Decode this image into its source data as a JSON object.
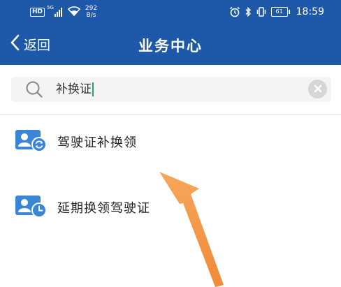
{
  "status_bar": {
    "hd_badge": "HD",
    "network_type": "5G",
    "speed_value": "292",
    "speed_unit": "B/s",
    "battery": "61",
    "time": "18:59"
  },
  "nav": {
    "back_label": "返回",
    "title": "业务中心"
  },
  "search": {
    "value": "补换证"
  },
  "results": [
    {
      "label": "驾驶证补换领",
      "icon": "license-refresh-icon"
    },
    {
      "label": "延期换领驾驶证",
      "icon": "license-clock-icon"
    }
  ],
  "colors": {
    "header_blue": "#1e59a9",
    "icon_blue": "#3a86d6",
    "caret_green": "#1aa66a",
    "arrow_orange": "#f39a4b"
  }
}
